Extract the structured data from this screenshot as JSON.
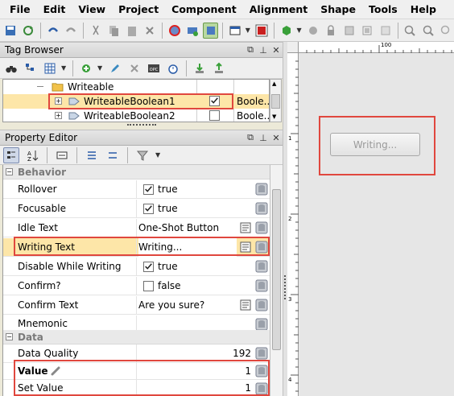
{
  "menu": [
    "File",
    "Edit",
    "View",
    "Project",
    "Component",
    "Alignment",
    "Shape",
    "Tools",
    "Help"
  ],
  "tag_browser": {
    "title": "Tag Browser",
    "folder": "Writeable",
    "rows": [
      {
        "name": "WriteableBoolean1",
        "checked": true,
        "type": "Boole..."
      },
      {
        "name": "WriteableBoolean2",
        "checked": false,
        "type": "Boole..."
      }
    ]
  },
  "property_editor": {
    "title": "Property Editor",
    "categories": {
      "behavior": "Behavior",
      "data": "Data"
    },
    "props": {
      "rollover": {
        "label": "Rollover",
        "value": "true",
        "checked": true
      },
      "focusable": {
        "label": "Focusable",
        "value": "true",
        "checked": true
      },
      "idle_text": {
        "label": "Idle Text",
        "value": "One-Shot Button"
      },
      "writing_text": {
        "label": "Writing Text",
        "value": "Writing..."
      },
      "disable_while_writing": {
        "label": "Disable While Writing",
        "value": "true",
        "checked": true
      },
      "confirm": {
        "label": "Confirm?",
        "value": "false",
        "checked": false
      },
      "confirm_text": {
        "label": "Confirm Text",
        "value": "Are you sure?"
      },
      "mnemonic": {
        "label": "Mnemonic",
        "value": ""
      },
      "data_quality": {
        "label": "Data Quality",
        "value": "192"
      },
      "value": {
        "label": "Value",
        "value": "1"
      },
      "set_value": {
        "label": "Set Value",
        "value": "1"
      }
    }
  },
  "designer": {
    "button_text": "Writing...",
    "ruler_top_label": "100",
    "ruler_left_labels": [
      "1",
      "2",
      "3",
      "4"
    ]
  },
  "colors": {
    "highlight_red": "#e0473e",
    "selected_row": "#fde6a8"
  }
}
